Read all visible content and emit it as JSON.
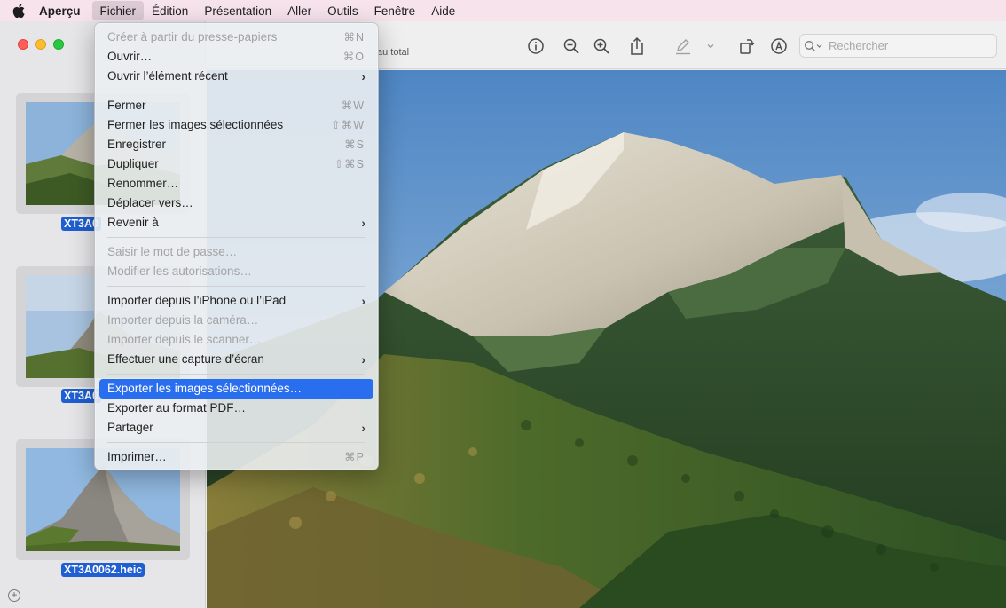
{
  "menubar": {
    "items": [
      "Aperçu",
      "Fichier",
      "Édition",
      "Présentation",
      "Aller",
      "Outils",
      "Fenêtre",
      "Aide"
    ],
    "active": "Fichier"
  },
  "window": {
    "subtitle": "au total",
    "search_placeholder": "Rechercher",
    "thumbnails": [
      {
        "label": "XT3A0"
      },
      {
        "label": "XT3A0"
      },
      {
        "label": "XT3A0062.heic"
      }
    ]
  },
  "file_menu": {
    "items": [
      {
        "label": "Créer à partir du presse-papiers",
        "shortcut": "⌘N",
        "disabled": true
      },
      {
        "label": "Ouvrir…",
        "shortcut": "⌘O"
      },
      {
        "label": "Ouvrir l’élément récent",
        "submenu": true
      },
      {
        "separator": true
      },
      {
        "label": "Fermer",
        "shortcut": "⌘W"
      },
      {
        "label": "Fermer les images sélectionnées",
        "shortcut": "⇧⌘W"
      },
      {
        "label": "Enregistrer",
        "shortcut": "⌘S"
      },
      {
        "label": "Dupliquer",
        "shortcut": "⇧⌘S"
      },
      {
        "label": "Renommer…"
      },
      {
        "label": "Déplacer vers…"
      },
      {
        "label": "Revenir à",
        "submenu": true
      },
      {
        "separator": true
      },
      {
        "label": "Saisir le mot de passe…",
        "disabled": true
      },
      {
        "label": "Modifier les autorisations…",
        "disabled": true
      },
      {
        "separator": true
      },
      {
        "label": "Importer depuis l’iPhone ou l’iPad",
        "submenu": true
      },
      {
        "label": "Importer depuis la caméra…",
        "disabled": true
      },
      {
        "label": "Importer depuis le scanner…",
        "disabled": true
      },
      {
        "label": "Effectuer une capture d’écran",
        "submenu": true
      },
      {
        "separator": true
      },
      {
        "label": "Exporter les images sélectionnées…",
        "highlighted": true
      },
      {
        "label": "Exporter au format PDF…"
      },
      {
        "label": "Partager",
        "submenu": true
      },
      {
        "separator": true
      },
      {
        "label": "Imprimer…",
        "shortcut": "⌘P"
      }
    ]
  },
  "colors": {
    "accent": "#2a6ef0",
    "selection_label": "#1f5fd1",
    "menubar": "#f7e3ec"
  },
  "icons": [
    "apple-icon",
    "info-icon",
    "zoom-out-icon",
    "zoom-in-icon",
    "share-icon",
    "markup-pen-icon",
    "chevron-down-icon",
    "rotate-icon",
    "annotate-icon",
    "search-icon",
    "add-icon"
  ]
}
